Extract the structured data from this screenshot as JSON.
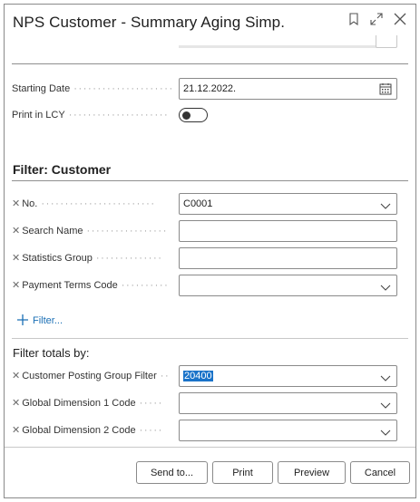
{
  "dialog": {
    "title": "NPS Customer - Summary Aging Simp.",
    "icons": [
      "bookmark-icon",
      "expand-icon",
      "close-icon"
    ]
  },
  "options": {
    "starting_date_label": "Starting Date",
    "starting_date_value": "21.12.2022.",
    "print_lcy_label": "Print in LCY",
    "print_lcy_on": false
  },
  "filter_customer": {
    "title": "Filter: Customer",
    "fields": [
      {
        "label": "No.",
        "value": "C0001",
        "dropdown": true
      },
      {
        "label": "Search Name",
        "value": "",
        "dropdown": false
      },
      {
        "label": "Statistics Group",
        "value": "",
        "dropdown": false
      },
      {
        "label": "Payment Terms Code",
        "value": "",
        "dropdown": true
      }
    ],
    "add_filter_label": "Filter..."
  },
  "filter_totals": {
    "title": "Filter totals by:",
    "fields": [
      {
        "label": "Customer Posting Group Filter",
        "value": "20400",
        "dropdown": true,
        "selected": true
      },
      {
        "label": "Global Dimension 1 Code",
        "value": "",
        "dropdown": true
      },
      {
        "label": "Global Dimension 2 Code",
        "value": "",
        "dropdown": true
      }
    ]
  },
  "footer": {
    "send_to": "Send to...",
    "print": "Print",
    "preview": "Preview",
    "cancel": "Cancel"
  },
  "colors": {
    "accent": "#1a73c9",
    "link": "#1a6fb5",
    "border": "#8a8a8a"
  }
}
